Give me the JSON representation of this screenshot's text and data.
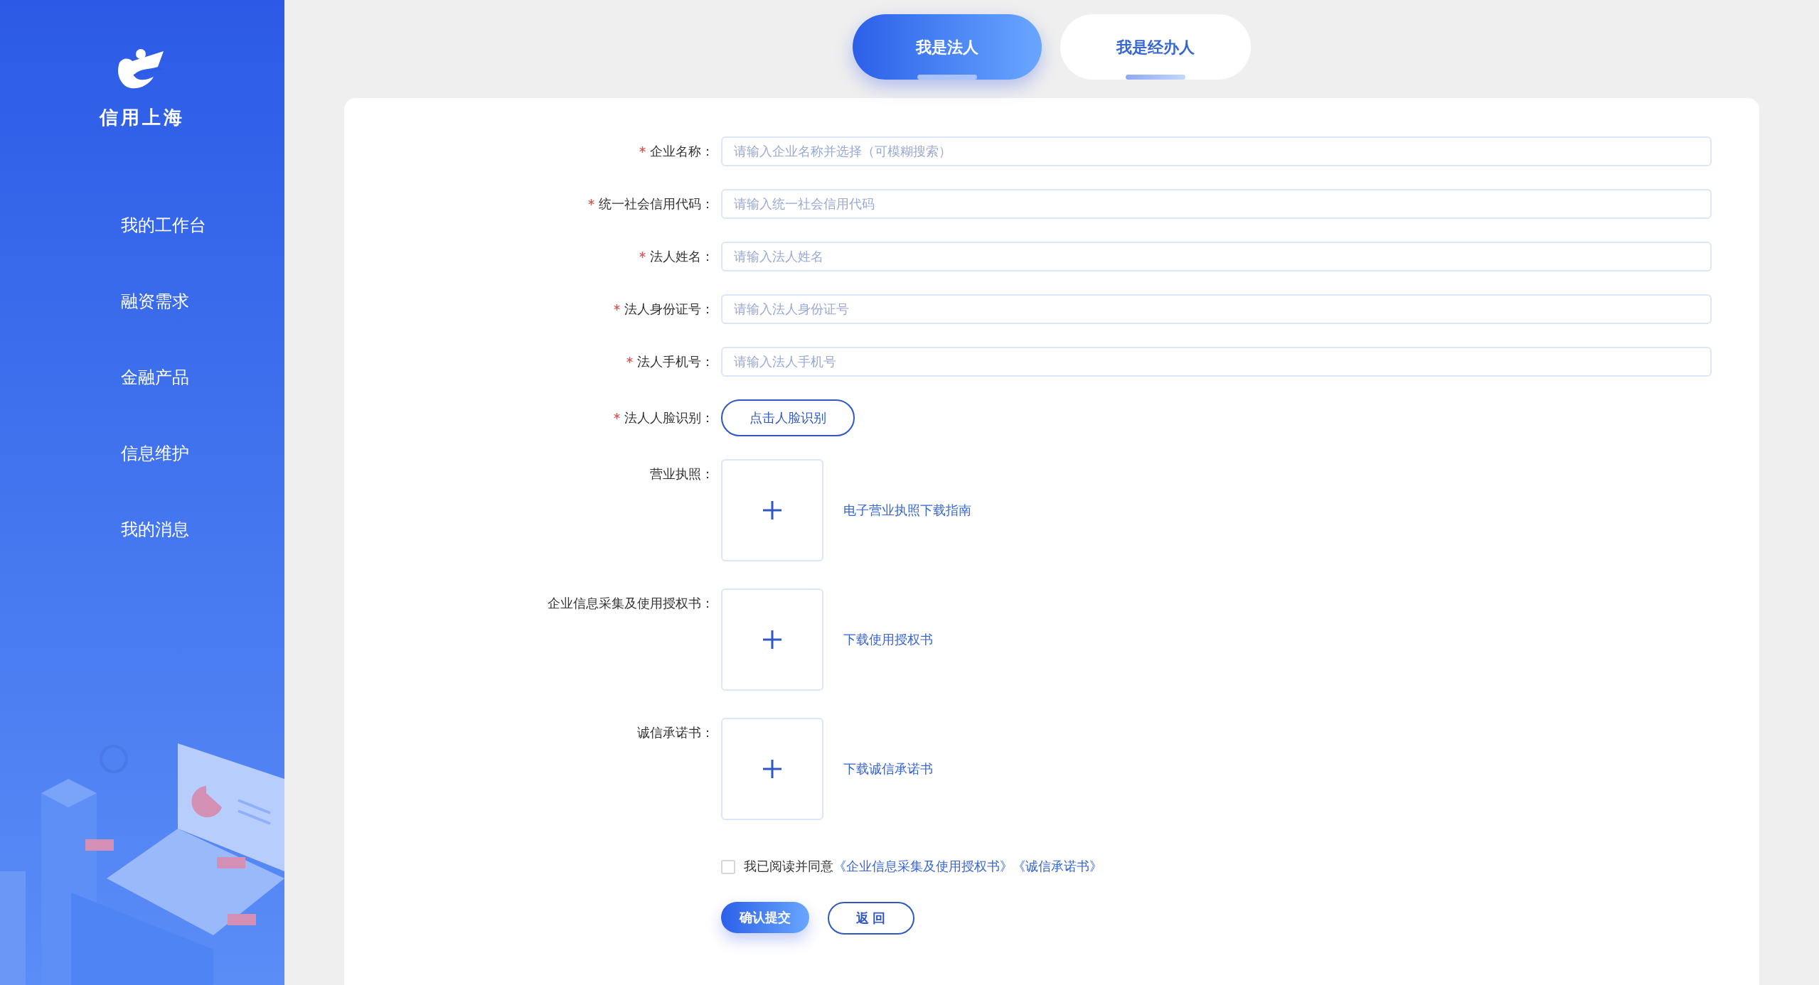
{
  "sidebar": {
    "logo_text": "信用上海",
    "nav_items": [
      {
        "label": "我的工作台"
      },
      {
        "label": "融资需求"
      },
      {
        "label": "金融产品"
      },
      {
        "label": "信息维护"
      },
      {
        "label": "我的消息"
      }
    ]
  },
  "tabs": [
    {
      "label": "我是法人",
      "selected": true
    },
    {
      "label": "我是经办人",
      "selected": false
    }
  ],
  "form": {
    "fields": [
      {
        "kind": "input",
        "label": "企业名称：",
        "required": true,
        "placeholder": "请输入企业名称并选择（可模糊搜索）"
      },
      {
        "kind": "input",
        "label": "统一社会信用代码：",
        "required": true,
        "placeholder": "请输入统一社会信用代码"
      },
      {
        "kind": "input",
        "label": "法人姓名：",
        "required": true,
        "placeholder": "请输入法人姓名"
      },
      {
        "kind": "input",
        "label": "法人身份证号：",
        "required": true,
        "placeholder": "请输入法人身份证号"
      },
      {
        "kind": "input",
        "label": "法人手机号：",
        "required": true,
        "placeholder": "请输入法人手机号"
      },
      {
        "kind": "action",
        "label": "法人人脸识别：",
        "required": true,
        "button": "点击人脸识别"
      },
      {
        "kind": "upload",
        "label": "营业执照：",
        "required": false,
        "link": "电子营业执照下载指南"
      },
      {
        "kind": "upload",
        "label": "企业信息采集及使用授权书：",
        "required": false,
        "link": "下载使用授权书"
      },
      {
        "kind": "upload",
        "label": "诚信承诺书：",
        "required": false,
        "link": "下载诚信承诺书"
      }
    ]
  },
  "agreement": {
    "checked": false,
    "text": "我已阅读并同意",
    "links": [
      "《企业信息采集及使用授权书》",
      "《诚信承诺书》"
    ]
  },
  "buttons": [
    {
      "kind": "primary",
      "label": "确认提交"
    },
    {
      "kind": "secondary",
      "label": "返 回"
    }
  ]
}
